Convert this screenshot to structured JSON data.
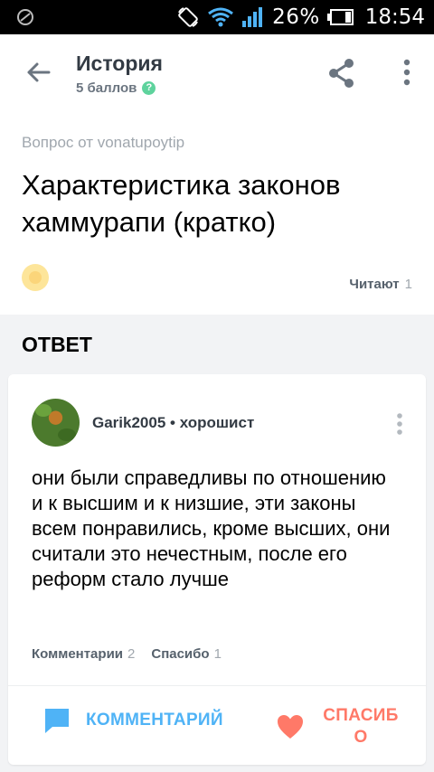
{
  "status_bar": {
    "battery_percent": "26%",
    "time": "18:54"
  },
  "app_bar": {
    "title": "История",
    "points": "5 баллов",
    "help_symbol": "?"
  },
  "question": {
    "author": "Вопрос от vonatupoytip",
    "title": "Характеристика законов хаммурапи (кратко)",
    "readers_label": "Читают",
    "readers_count": "1"
  },
  "answer_section": {
    "heading": "ОТВЕТ"
  },
  "answer": {
    "username": "Garik2005",
    "separator": " • ",
    "rank": "хорошист",
    "text": "они были справедливы по отношению и к высшим и к низшие, эти законы всем понравились, кроме высших, они считали это нечестным, после его реформ стало лучше",
    "comments_label": "Комментарии",
    "comments_count": "2",
    "thanks_label": "Спасибо",
    "thanks_count": "1",
    "comment_button": "КОММЕНТАРИЙ",
    "thanks_button": "СПАСИБО"
  },
  "colors": {
    "accent_blue": "#4fb3f6",
    "accent_red": "#ff7968",
    "help_green": "#5ed39d"
  },
  "icons": [
    "back-arrow-icon",
    "share-icon",
    "more-vertical-icon",
    "comment-icon",
    "heart-icon",
    "wifi-icon",
    "signal-icon",
    "battery-icon",
    "rotate-icon",
    "app-notification-icon"
  ]
}
